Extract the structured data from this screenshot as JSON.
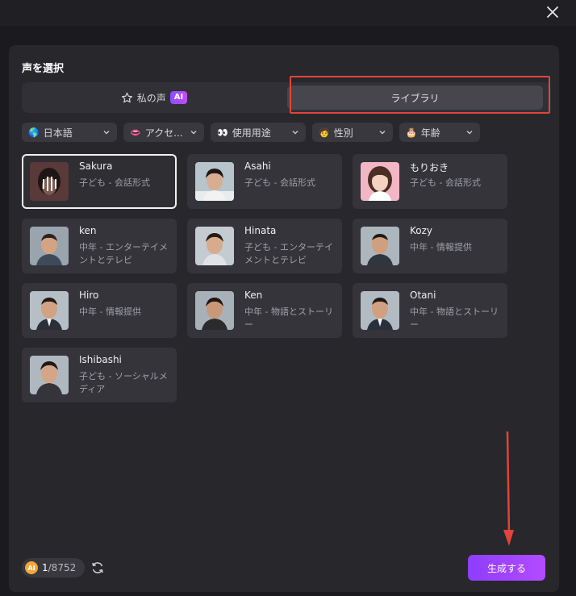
{
  "dialog": {
    "title": "声を選択"
  },
  "tabs": {
    "my_voice_label": "私の声",
    "ai_badge": "AI",
    "library_label": "ライブラリ"
  },
  "filters": [
    {
      "emoji": "🌎",
      "label": "日本語"
    },
    {
      "emoji": "👄",
      "label": "アクセ..."
    },
    {
      "emoji": "👀",
      "label": "使用用途"
    },
    {
      "emoji": "🧑",
      "label": "性別"
    },
    {
      "emoji": "🎂",
      "label": "年齢"
    }
  ],
  "voices": [
    {
      "name": "Sakura",
      "desc": "子ども - 会話形式",
      "selected": true
    },
    {
      "name": "Asahi",
      "desc": "子ども - 会話形式"
    },
    {
      "name": "もりおき",
      "desc": "子ども - 会話形式"
    },
    {
      "name": "ken",
      "desc": "中年 - エンターテイメントとテレビ"
    },
    {
      "name": "Hinata",
      "desc": "子ども - エンターテイメントとテレビ"
    },
    {
      "name": "Kozy",
      "desc": "中年 - 情報提供"
    },
    {
      "name": "Hiro",
      "desc": "中年 - 情報提供"
    },
    {
      "name": "Ken",
      "desc": "中年 - 物語とストーリー"
    },
    {
      "name": "Otani",
      "desc": "中年 - 物語とストーリー"
    },
    {
      "name": "Ishibashi",
      "desc": "子ども - ソーシャルメディア"
    }
  ],
  "footer": {
    "coin_label": "AI",
    "credits_used": "1",
    "credits_total": "/8752",
    "generate_label": "生成する"
  },
  "colors": {
    "accent": "#9b44ff",
    "highlight": "#e0443a",
    "panel": "#27272c"
  }
}
